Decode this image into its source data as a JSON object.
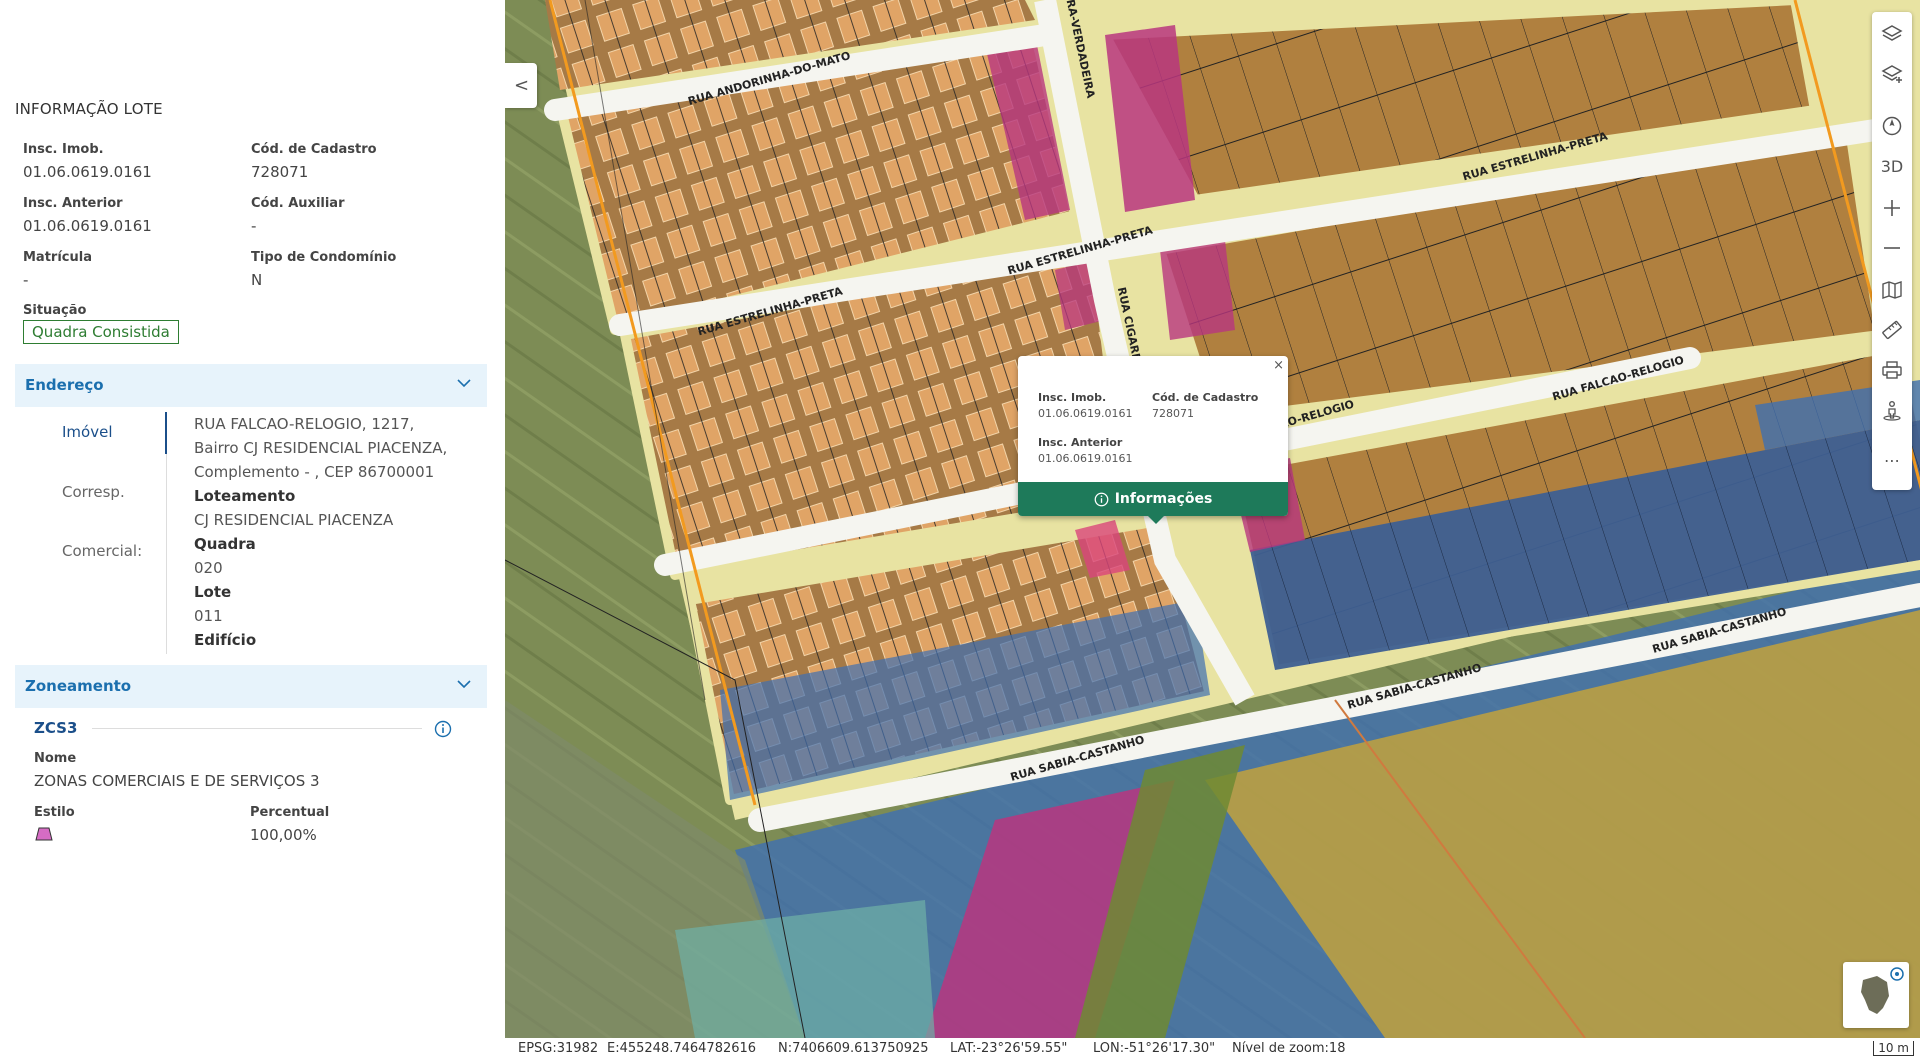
{
  "panel": {
    "title": "INFORMAÇÃO LOTE",
    "fields": {
      "insc_imob_label": "Insc. Imob.",
      "insc_imob_value": "01.06.0619.0161",
      "cod_cadastro_label": "Cód. de Cadastro",
      "cod_cadastro_value": "728071",
      "insc_anterior_label": "Insc. Anterior",
      "insc_anterior_value": "01.06.0619.0161",
      "cod_auxiliar_label": "Cód. Auxiliar",
      "cod_auxiliar_value": "-",
      "matricula_label": "Matrícula",
      "matricula_value": "-",
      "tipo_condominio_label": "Tipo de Condomínio",
      "tipo_condominio_value": "N",
      "situacao_label": "Situação",
      "situacao_value": "Quadra Consistida"
    },
    "endereco": {
      "header": "Endereço",
      "tabs": [
        "Imóvel",
        "Corresp.",
        "Comercial:"
      ],
      "lines": [
        "RUA FALCAO-RELOGIO, 1217,",
        "Bairro CJ RESIDENCIAL PIACENZA,",
        "Complemento - , CEP 86700001"
      ],
      "loteamento_label": "Loteamento",
      "loteamento_value": "CJ RESIDENCIAL PIACENZA",
      "quadra_label": "Quadra",
      "quadra_value": "020",
      "lote_label": "Lote",
      "lote_value": "011",
      "edificio_label": "Edifício"
    },
    "zoneamento": {
      "header": "Zoneamento",
      "code": "ZCS3",
      "nome_label": "Nome",
      "nome_value": "ZONAS COMERCIAIS E DE SERVIÇOS 3",
      "estilo_label": "Estilo",
      "percentual_label": "Percentual",
      "percentual_value": "100,00%",
      "style_color": "#c04aa8"
    }
  },
  "popup": {
    "close": "×",
    "insc_imob_label": "Insc. Imob.",
    "insc_imob_value": "01.06.0619.0161",
    "cod_cadastro_label": "Cód. de Cadastro",
    "cod_cadastro_value": "728071",
    "insc_anterior_label": "Insc. Anterior",
    "insc_anterior_value": "01.06.0619.0161",
    "button": "Informações"
  },
  "streets": [
    "RUA ANDORINHA-DO-MATO",
    "RUA ESTRELINHA-PRETA",
    "RUA ESTRELINHA-PRETA",
    "RUA ESTRELINHA-PRETA",
    "CARRA-VERDADEIRA",
    "RUA CIGARR",
    "FALCAO-RELOGIO",
    "RUA FALCAO-RELOGIO",
    "RUA SABIA-CASTANHO",
    "RUA SABIA-CASTANHO",
    "RUA SABIA-CASTANHO"
  ],
  "toolbar": {
    "three_d": "3D",
    "more": "⋯"
  },
  "collapse": "<",
  "status": {
    "epsg": "EPSG:31982",
    "easting": "E:455248.7464782616",
    "northing": "N:7406609.613750925",
    "lat": "LAT:-23°26'59.55\"",
    "lon": "LON:-51°26'17.30\"",
    "zoom": "Nível de zoom:18",
    "scale": "10 m"
  },
  "colors": {
    "accent": "#1b6fae",
    "section_bg": "#e7f3fb",
    "badge_green": "#2e7d32",
    "popup_button": "#1e7a5a",
    "zone_magenta": "#b8367f",
    "zone_blue": "#3f6fb2",
    "zone_orange": "#c98a36",
    "road": "#e8e3a2"
  }
}
